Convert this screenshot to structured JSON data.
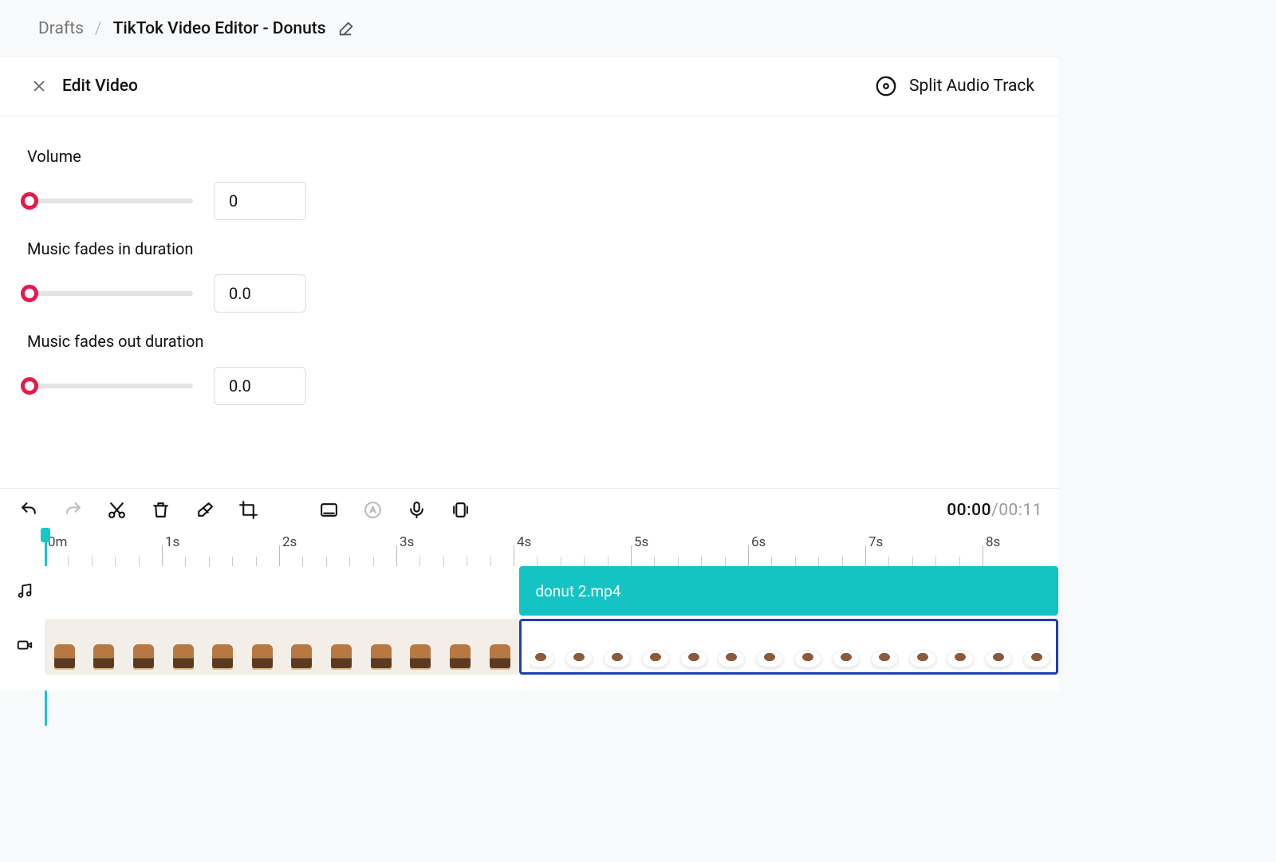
{
  "breadcrumb": {
    "root": "Drafts",
    "sep": "/",
    "title": "TikTok Video Editor - Donuts"
  },
  "header": {
    "edit_video": "Edit Video",
    "split_audio": "Split Audio Track"
  },
  "controls": {
    "volume_label": "Volume",
    "volume_value": "0",
    "fade_in_label": "Music fades in duration",
    "fade_in_value": "0.0",
    "fade_out_label": "Music fades out duration",
    "fade_out_value": "0.0"
  },
  "timeline": {
    "current": "00:00",
    "total": "/00:11",
    "ticks": [
      "0m",
      "1s",
      "2s",
      "3s",
      "4s",
      "5s",
      "6s",
      "7s",
      "8s"
    ],
    "audio_clip_label": "donut 2.mp4"
  }
}
